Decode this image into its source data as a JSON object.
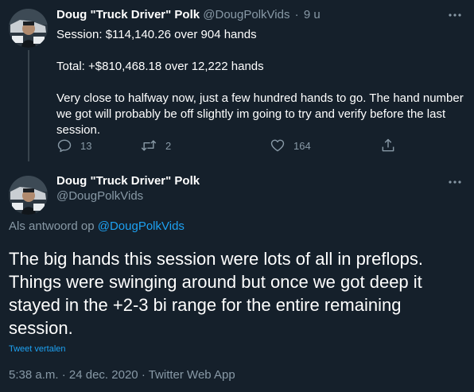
{
  "colors": {
    "background": "#15202b",
    "text_primary": "#ffffff",
    "text_secondary": "#8899a6",
    "accent": "#1da1f2",
    "divider": "#38444d"
  },
  "previous_tweet": {
    "display_name": "Doug \"Truck Driver\" Polk",
    "handle": "@DougPolkVids",
    "separator": "·",
    "time": "9 u",
    "more_icon": "more-horizontal-icon",
    "body": {
      "line1": "Session: $114,140.26 over 904 hands",
      "line2": "Total: +$810,468.18 over 12,222 hands",
      "line3": "Very close to halfway now, just a few hundred hands to go. The hand number we got will probably be off slightly im going to try and verify before the last session."
    },
    "actions": {
      "reply": {
        "icon": "reply-icon",
        "count": "13"
      },
      "retweet": {
        "icon": "retweet-icon",
        "count": "2"
      },
      "like": {
        "icon": "like-icon",
        "count": "164"
      },
      "share": {
        "icon": "share-icon"
      }
    }
  },
  "main_tweet": {
    "display_name": "Doug \"Truck Driver\" Polk",
    "handle": "@DougPolkVids",
    "more_icon": "more-horizontal-icon",
    "reply_prefix": "Als antwoord op",
    "reply_to_handle": "@DougPolkVids",
    "text": "The big hands this session were lots of all in preflops. Things were swinging around but once we got deep it stayed in the +2-3 bi range for the entire remaining session.",
    "translate_label": "Tweet vertalen",
    "time": "5:38 a.m.",
    "separator": "·",
    "date": "24 dec. 2020",
    "client": "Twitter Web App"
  }
}
